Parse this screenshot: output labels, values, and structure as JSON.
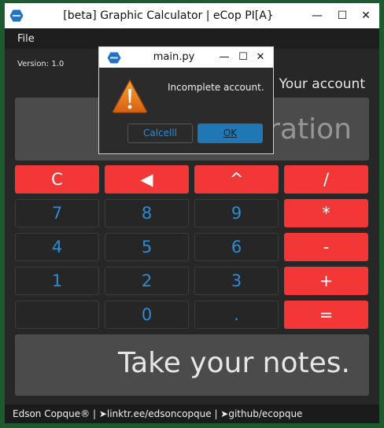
{
  "window": {
    "title": "[beta] Graphic Calculator | eCop PI[A}",
    "minimize_glyph": "—",
    "maximize_glyph": "☐",
    "close_glyph": "✕"
  },
  "menu": {
    "file": "File"
  },
  "version": "Version: 1.0",
  "account": "Your account",
  "display": {
    "placeholder": "Enter operation"
  },
  "keypad": {
    "keys": [
      {
        "label": "C",
        "style": "red"
      },
      {
        "label": "◀",
        "style": "red"
      },
      {
        "label": "^",
        "style": "red"
      },
      {
        "label": "/",
        "style": "red"
      },
      {
        "label": "7",
        "style": "dark"
      },
      {
        "label": "8",
        "style": "dark"
      },
      {
        "label": "9",
        "style": "dark"
      },
      {
        "label": "*",
        "style": "red"
      },
      {
        "label": "4",
        "style": "dark"
      },
      {
        "label": "5",
        "style": "dark"
      },
      {
        "label": "6",
        "style": "dark"
      },
      {
        "label": "-",
        "style": "red"
      },
      {
        "label": "1",
        "style": "dark"
      },
      {
        "label": "2",
        "style": "dark"
      },
      {
        "label": "3",
        "style": "dark"
      },
      {
        "label": "+",
        "style": "red"
      },
      {
        "label": "",
        "style": "dark"
      },
      {
        "label": "0",
        "style": "dark"
      },
      {
        "label": ".",
        "style": "dark"
      },
      {
        "label": "=",
        "style": "red"
      }
    ]
  },
  "notes": {
    "placeholder": "Take your notes."
  },
  "statusbar": {
    "text": "Edson Copque® | ➤linktr.ee/edsoncopque | ➤github/ecopque"
  },
  "dialog": {
    "title": "main.py",
    "message": "Incomplete account.",
    "cancel_label": "Calcelll",
    "ok_label": "OK",
    "minimize_glyph": "—",
    "maximize_glyph": "☐",
    "close_glyph": "✕"
  },
  "colors": {
    "accent_red": "#f33636",
    "key_text_blue": "#2b8bd4",
    "ok_button": "#1f78b4",
    "background": "#272727",
    "warning_icon": "#e8771a"
  },
  "icons": {
    "app_logo": "hexagon-logo-icon",
    "dialog_warning": "warning-triangle-icon"
  }
}
